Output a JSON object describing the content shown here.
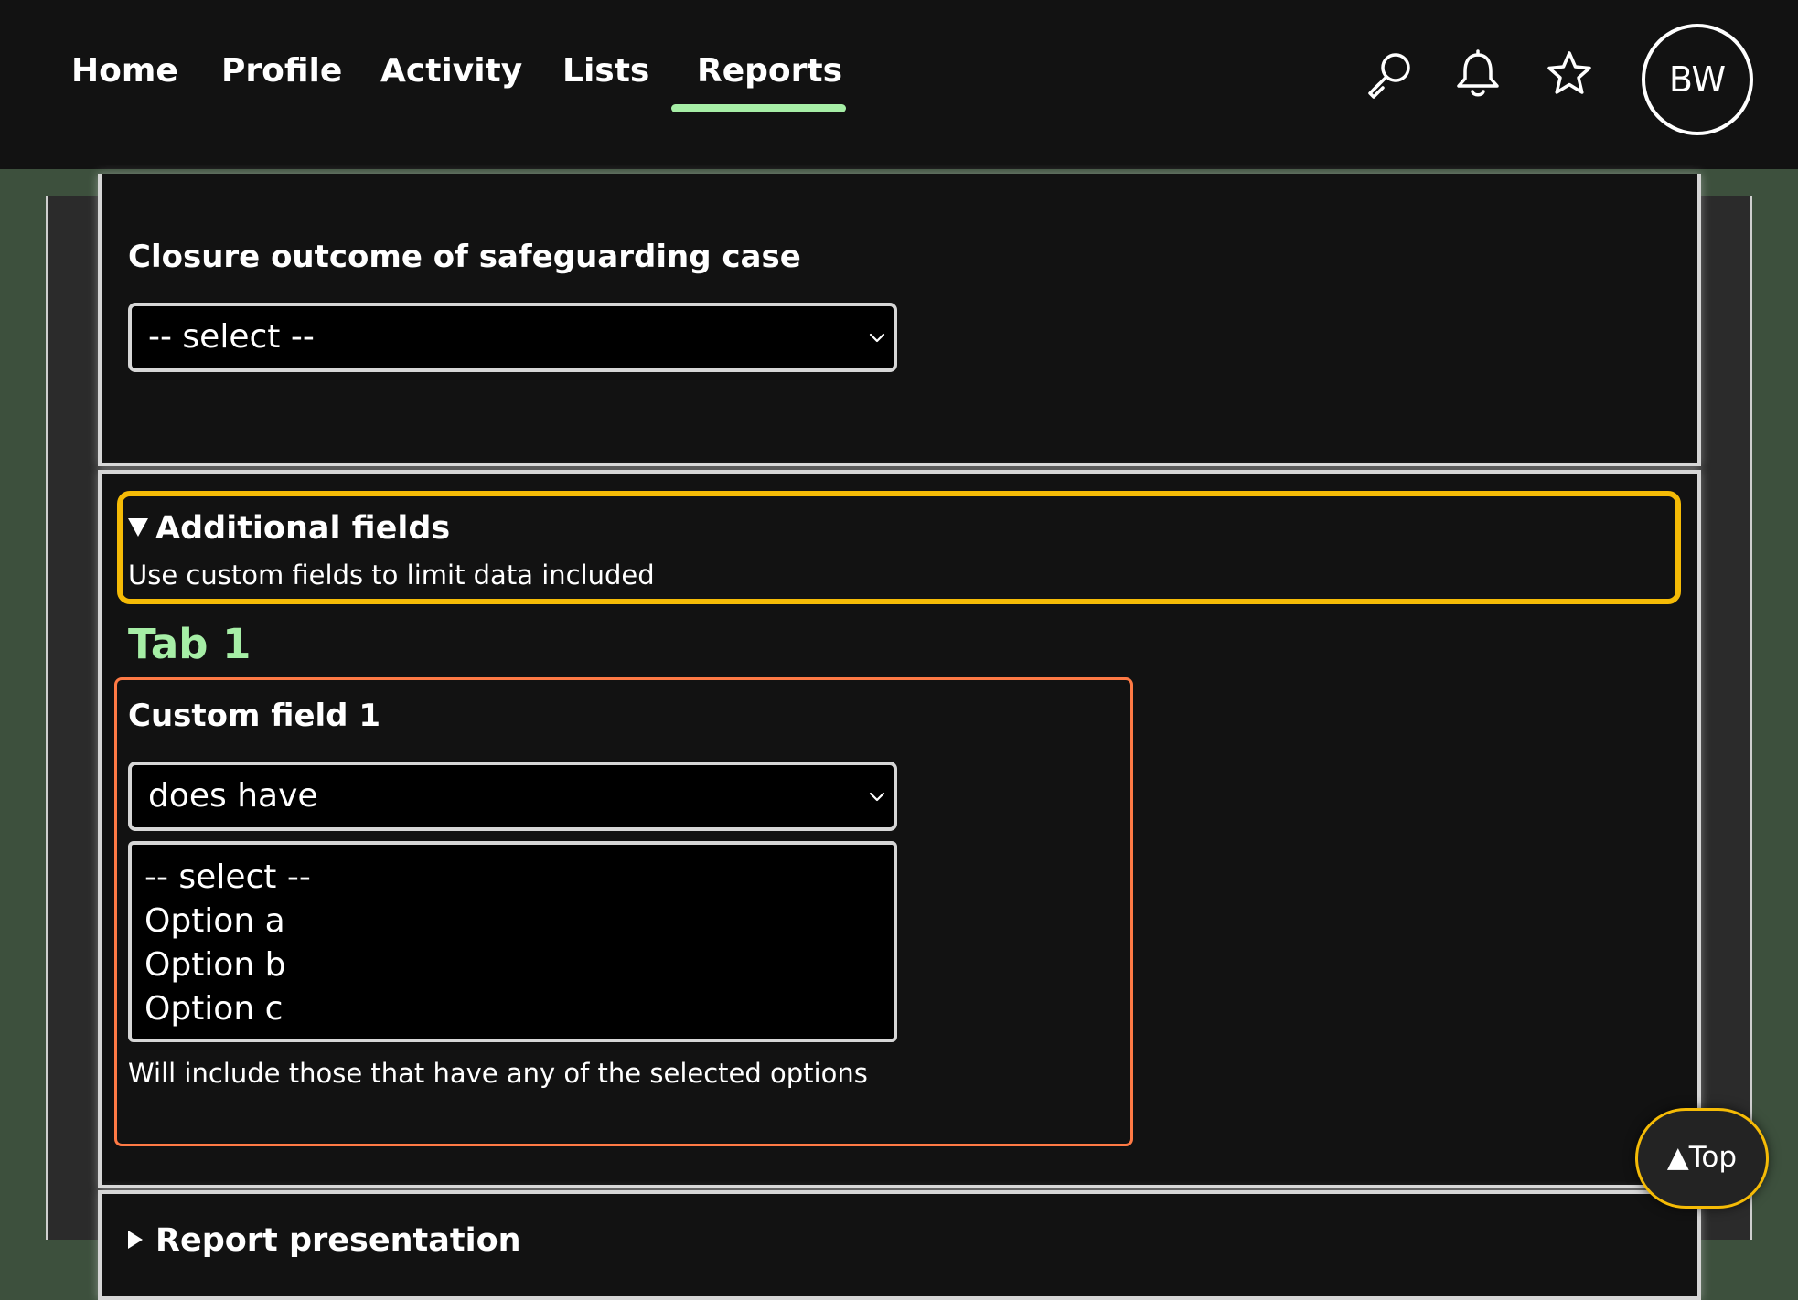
{
  "nav": {
    "items": [
      {
        "label": "Home"
      },
      {
        "label": "Profile"
      },
      {
        "label": "Activity"
      },
      {
        "label": "Lists"
      },
      {
        "label": "Reports"
      }
    ],
    "active": "Reports",
    "icons": [
      "search-icon",
      "bell-icon",
      "star-icon"
    ],
    "avatar_initials": "BW"
  },
  "closure": {
    "label": "Closure outcome of safeguarding case",
    "selected": "-- select --"
  },
  "additional": {
    "summary_title": "Additional fields",
    "summary_desc": "Use custom fields to limit data included",
    "tab_heading": "Tab 1",
    "custom_field": {
      "label": "Custom field 1",
      "mode_selected": "does have",
      "options": [
        "-- select --",
        "Option a",
        "Option b",
        "Option c"
      ],
      "help": "Will include those that have any of the selected options"
    }
  },
  "report": {
    "summary_title": "Report presentation"
  },
  "top_button": {
    "label": "▲Top"
  },
  "colors": {
    "nav_bg": "#121212",
    "page_bg": "#3d503d",
    "accent_green": "#a6eea6",
    "focus_yellow": "#f5bb06",
    "field_orange": "#ff7a45"
  }
}
